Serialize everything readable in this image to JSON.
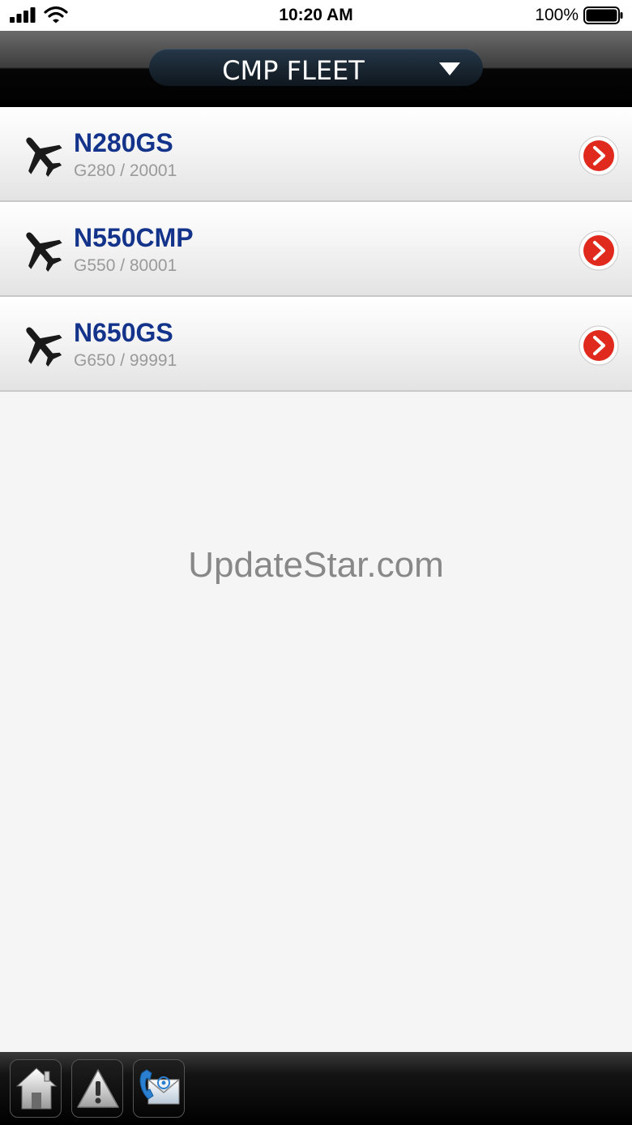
{
  "status_bar": {
    "time": "10:20 AM",
    "battery_percent": "100%",
    "icons": [
      "cellular-signal-icon",
      "wifi-icon",
      "battery-icon"
    ]
  },
  "header": {
    "title": "CMP FLEET",
    "caret_icon": "caret-down-icon"
  },
  "fleet": [
    {
      "tail": "N280GS",
      "model": "G280 / 20001"
    },
    {
      "tail": "N550CMP",
      "model": "G550 / 80001"
    },
    {
      "tail": "N650GS",
      "model": "G650 / 99991"
    }
  ],
  "watermark": "UpdateStar.com",
  "toolbar": {
    "buttons": [
      "home-icon",
      "alert-icon",
      "contact-icon"
    ]
  },
  "colors": {
    "tail_text": "#14338a",
    "model_text": "#9a9a9a",
    "arrow_red": "#e02a1e"
  }
}
